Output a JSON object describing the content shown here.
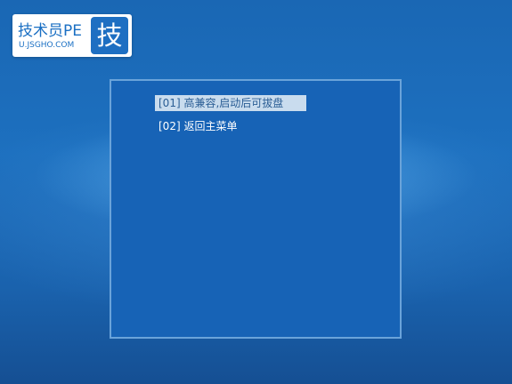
{
  "logo": {
    "name": "技术员PE",
    "url": "U.JSGHO.COM",
    "badge": "技"
  },
  "menu": {
    "items": [
      {
        "label": "[01] 高兼容,启动后可拔盘",
        "selected": true
      },
      {
        "label": "[02] 返回主菜单",
        "selected": false
      }
    ]
  },
  "colors": {
    "background": "#1d70bf",
    "panel": "#1763b6",
    "panel_border": "#6aa3da",
    "selection": "#c9dcee",
    "selected_text": "#2a5d94",
    "logo_blue": "#1a6fc3"
  }
}
